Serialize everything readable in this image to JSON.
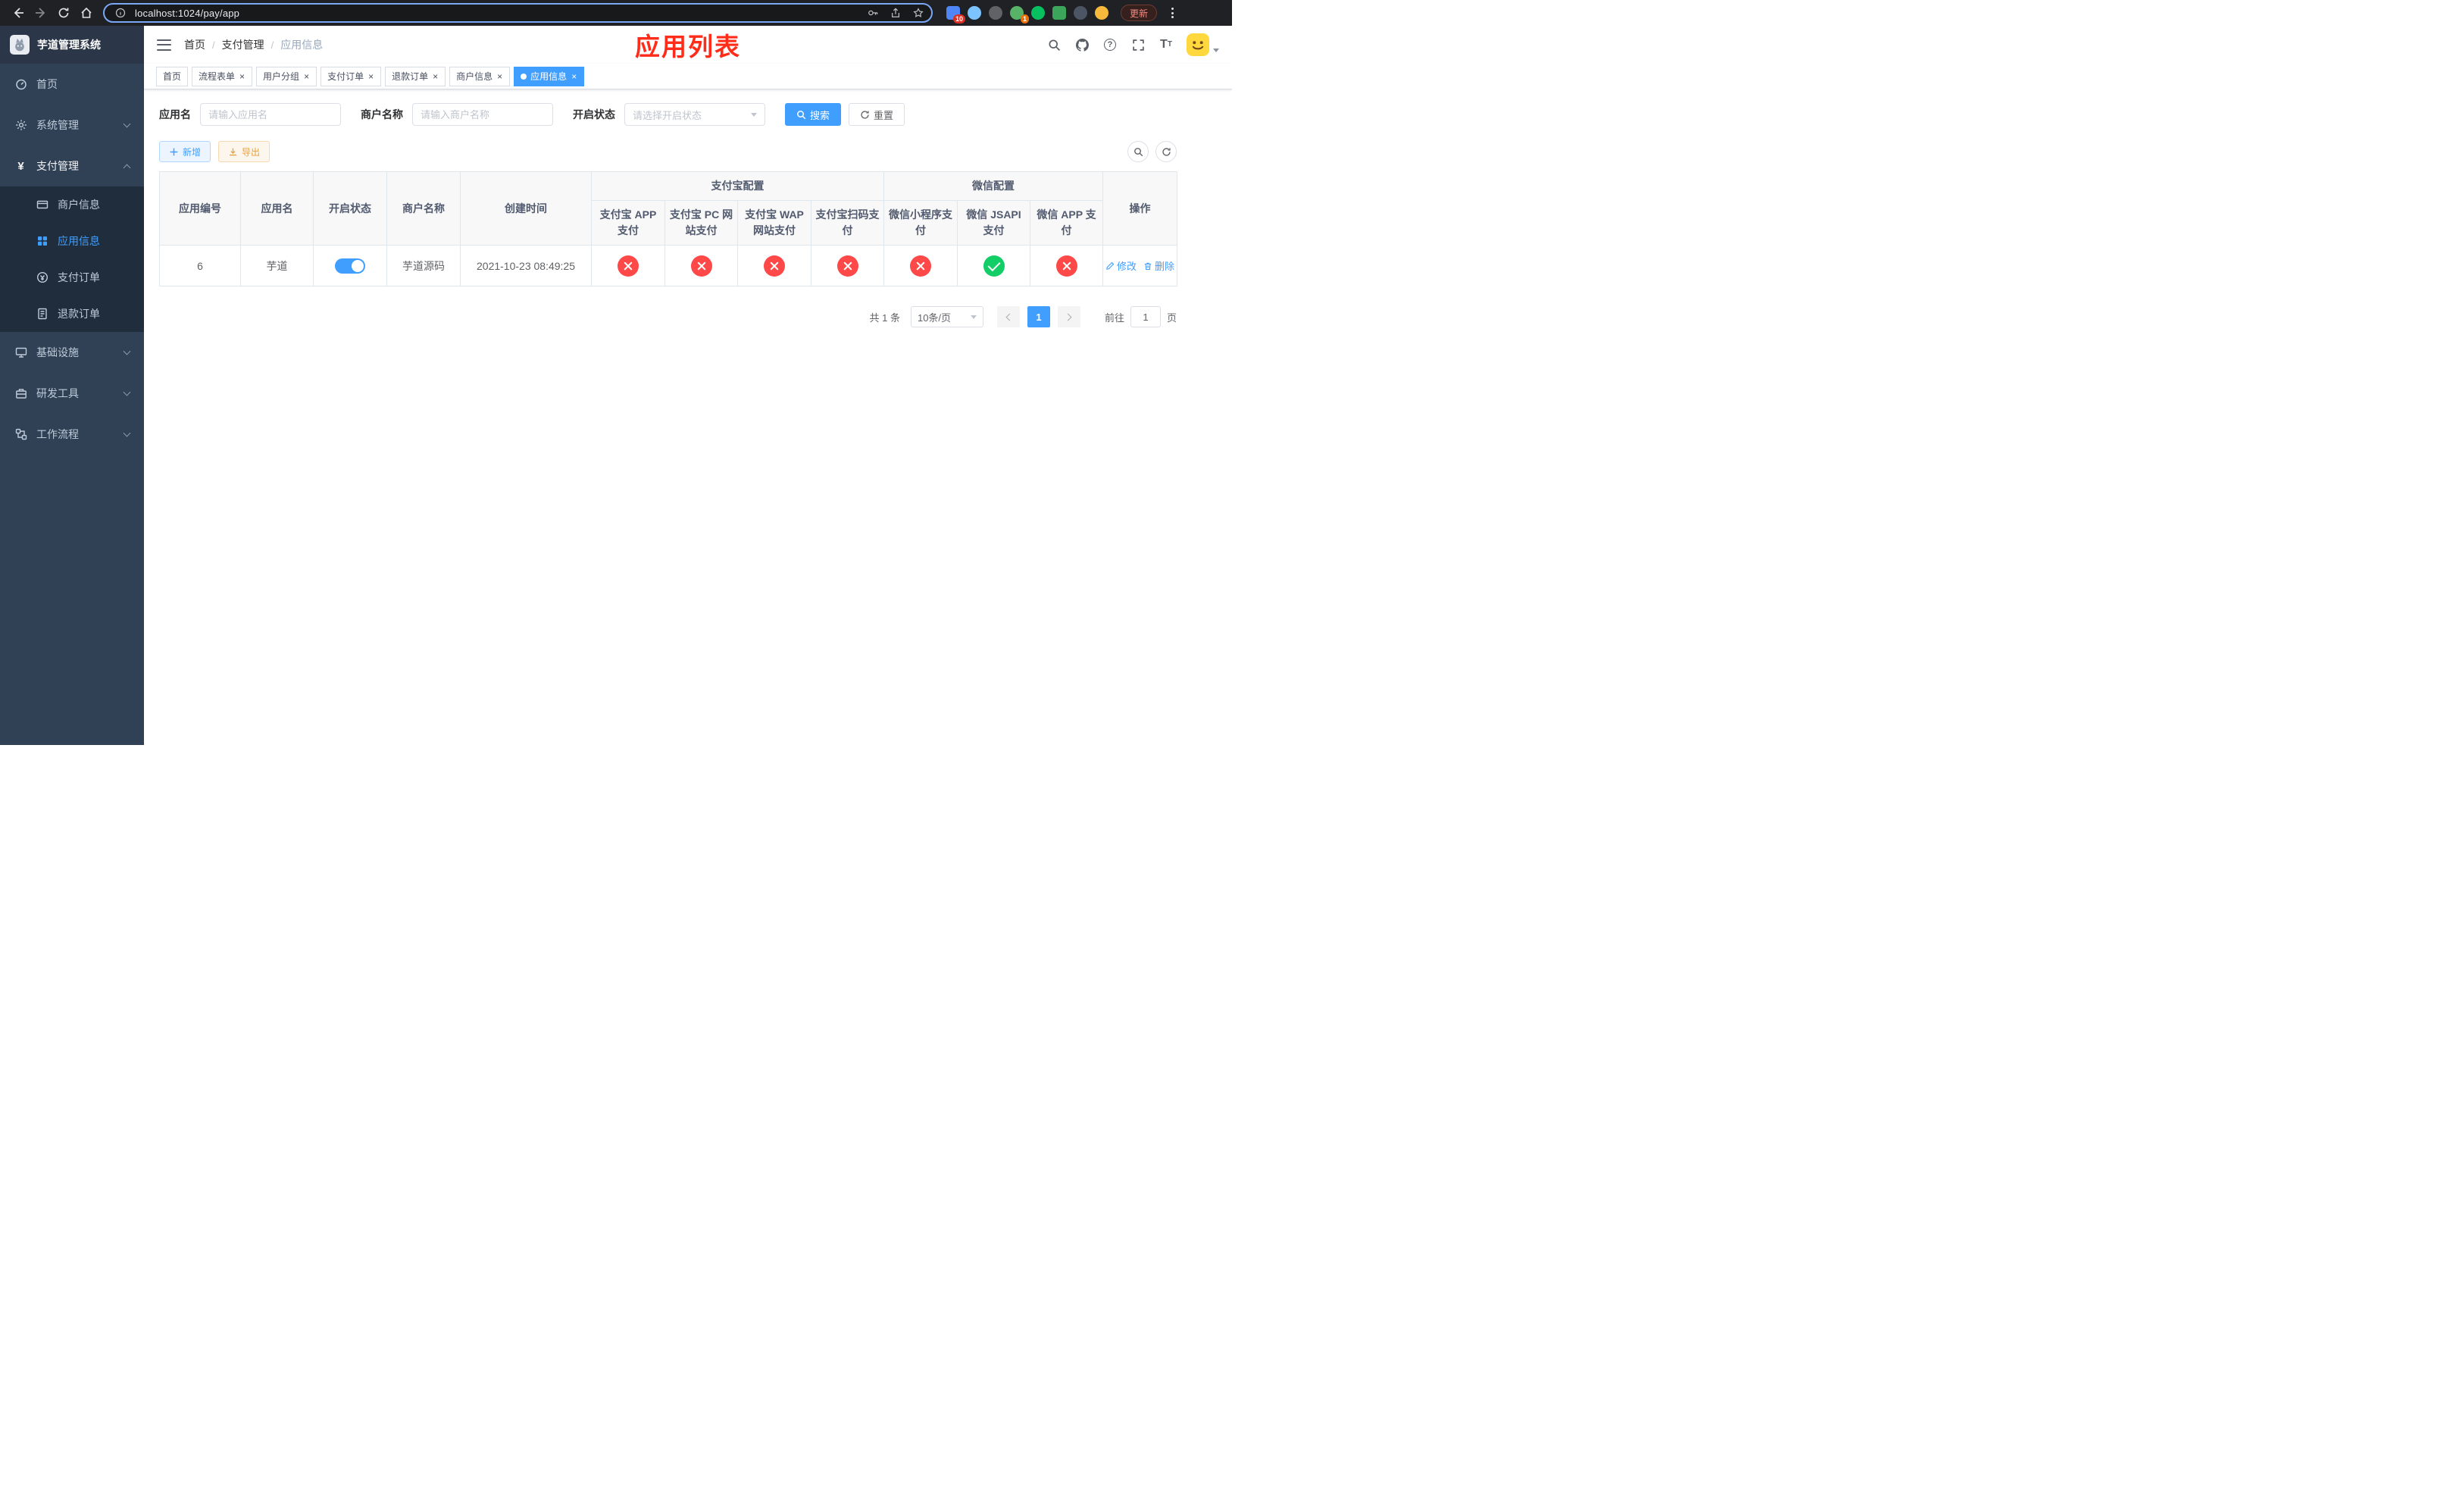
{
  "colors": {
    "primary": "#409eff",
    "sidebar_bg": "#304156",
    "submenu_bg": "#1f2d3d",
    "title_red": "#fe2c19",
    "success_green": "#13ce66",
    "danger_red": "#ff4949",
    "warning_orange": "#e6a23c",
    "active_tag_bg": "#409eff"
  },
  "browser": {
    "url": "localhost:1024/pay/app",
    "update_label": "更新",
    "extension_badge_1": "10",
    "extension_badge_2": "1"
  },
  "icons": {
    "back": "arrow-left",
    "forward": "arrow-right",
    "reload": "circular-arrow",
    "home": "house",
    "info": "circle-i",
    "key": "key",
    "share": "export-arrow",
    "star": "star-outline",
    "search": "magnifier",
    "github": "octocat",
    "help": "question-circle",
    "fullscreen": "expand-corners",
    "font_size": "double-T",
    "refresh": "circular-arrows",
    "add": "plus",
    "export": "download-arrow",
    "edit": "pencil",
    "delete": "trash",
    "enabled": "check",
    "disabled": "cross"
  },
  "sidebar": {
    "logo_title": "芋道管理系统",
    "items": [
      {
        "label": "首页"
      },
      {
        "label": "系统管理"
      },
      {
        "label": "支付管理"
      },
      {
        "label": "基础设施"
      },
      {
        "label": "研发工具"
      },
      {
        "label": "工作流程"
      }
    ],
    "pay_children": [
      {
        "label": "商户信息"
      },
      {
        "label": "应用信息"
      },
      {
        "label": "支付订单"
      },
      {
        "label": "退款订单"
      }
    ]
  },
  "navbar": {
    "breadcrumb": [
      "首页",
      "支付管理",
      "应用信息"
    ],
    "page_title": "应用列表"
  },
  "tabs": [
    {
      "label": "首页"
    },
    {
      "label": "流程表单"
    },
    {
      "label": "用户分组"
    },
    {
      "label": "支付订单"
    },
    {
      "label": "退款订单"
    },
    {
      "label": "商户信息"
    },
    {
      "label": "应用信息"
    }
  ],
  "filters": {
    "app_name_label": "应用名",
    "app_name_placeholder": "请输入应用名",
    "merchant_label": "商户名称",
    "merchant_placeholder": "请输入商户名称",
    "status_label": "开启状态",
    "status_placeholder": "请选择开启状态",
    "search_label": "搜索",
    "reset_label": "重置"
  },
  "toolbar": {
    "add_label": "新增",
    "export_label": "导出"
  },
  "table": {
    "main_columns": [
      "应用编号",
      "应用名",
      "开启状态",
      "商户名称",
      "创建时间"
    ],
    "alipay_group": "支付宝配置",
    "wechat_group": "微信配置",
    "alipay_columns": [
      "支付宝 APP 支付",
      "支付宝 PC 网站支付",
      "支付宝 WAP 网站支付",
      "支付宝扫码支付"
    ],
    "wechat_columns": [
      "微信小程序支付",
      "微信 JSAPI 支付",
      "微信 APP 支付"
    ],
    "op_column": "操作",
    "row": {
      "id": "6",
      "name": "芋道",
      "enabled": true,
      "merchant": "芋道源码",
      "create_time": "2021-10-23 08:49:25",
      "alipay_app": false,
      "alipay_pc": false,
      "alipay_wap": false,
      "alipay_qr": false,
      "wx_lite": false,
      "wx_jsapi": true,
      "wx_app": false,
      "edit_label": "修改",
      "delete_label": "删除"
    }
  },
  "pagination": {
    "total_label": "共 1 条",
    "page_size_label": "10条/页",
    "current_page": "1",
    "goto_prefix": "前往",
    "goto_value": "1",
    "goto_suffix": "页"
  }
}
